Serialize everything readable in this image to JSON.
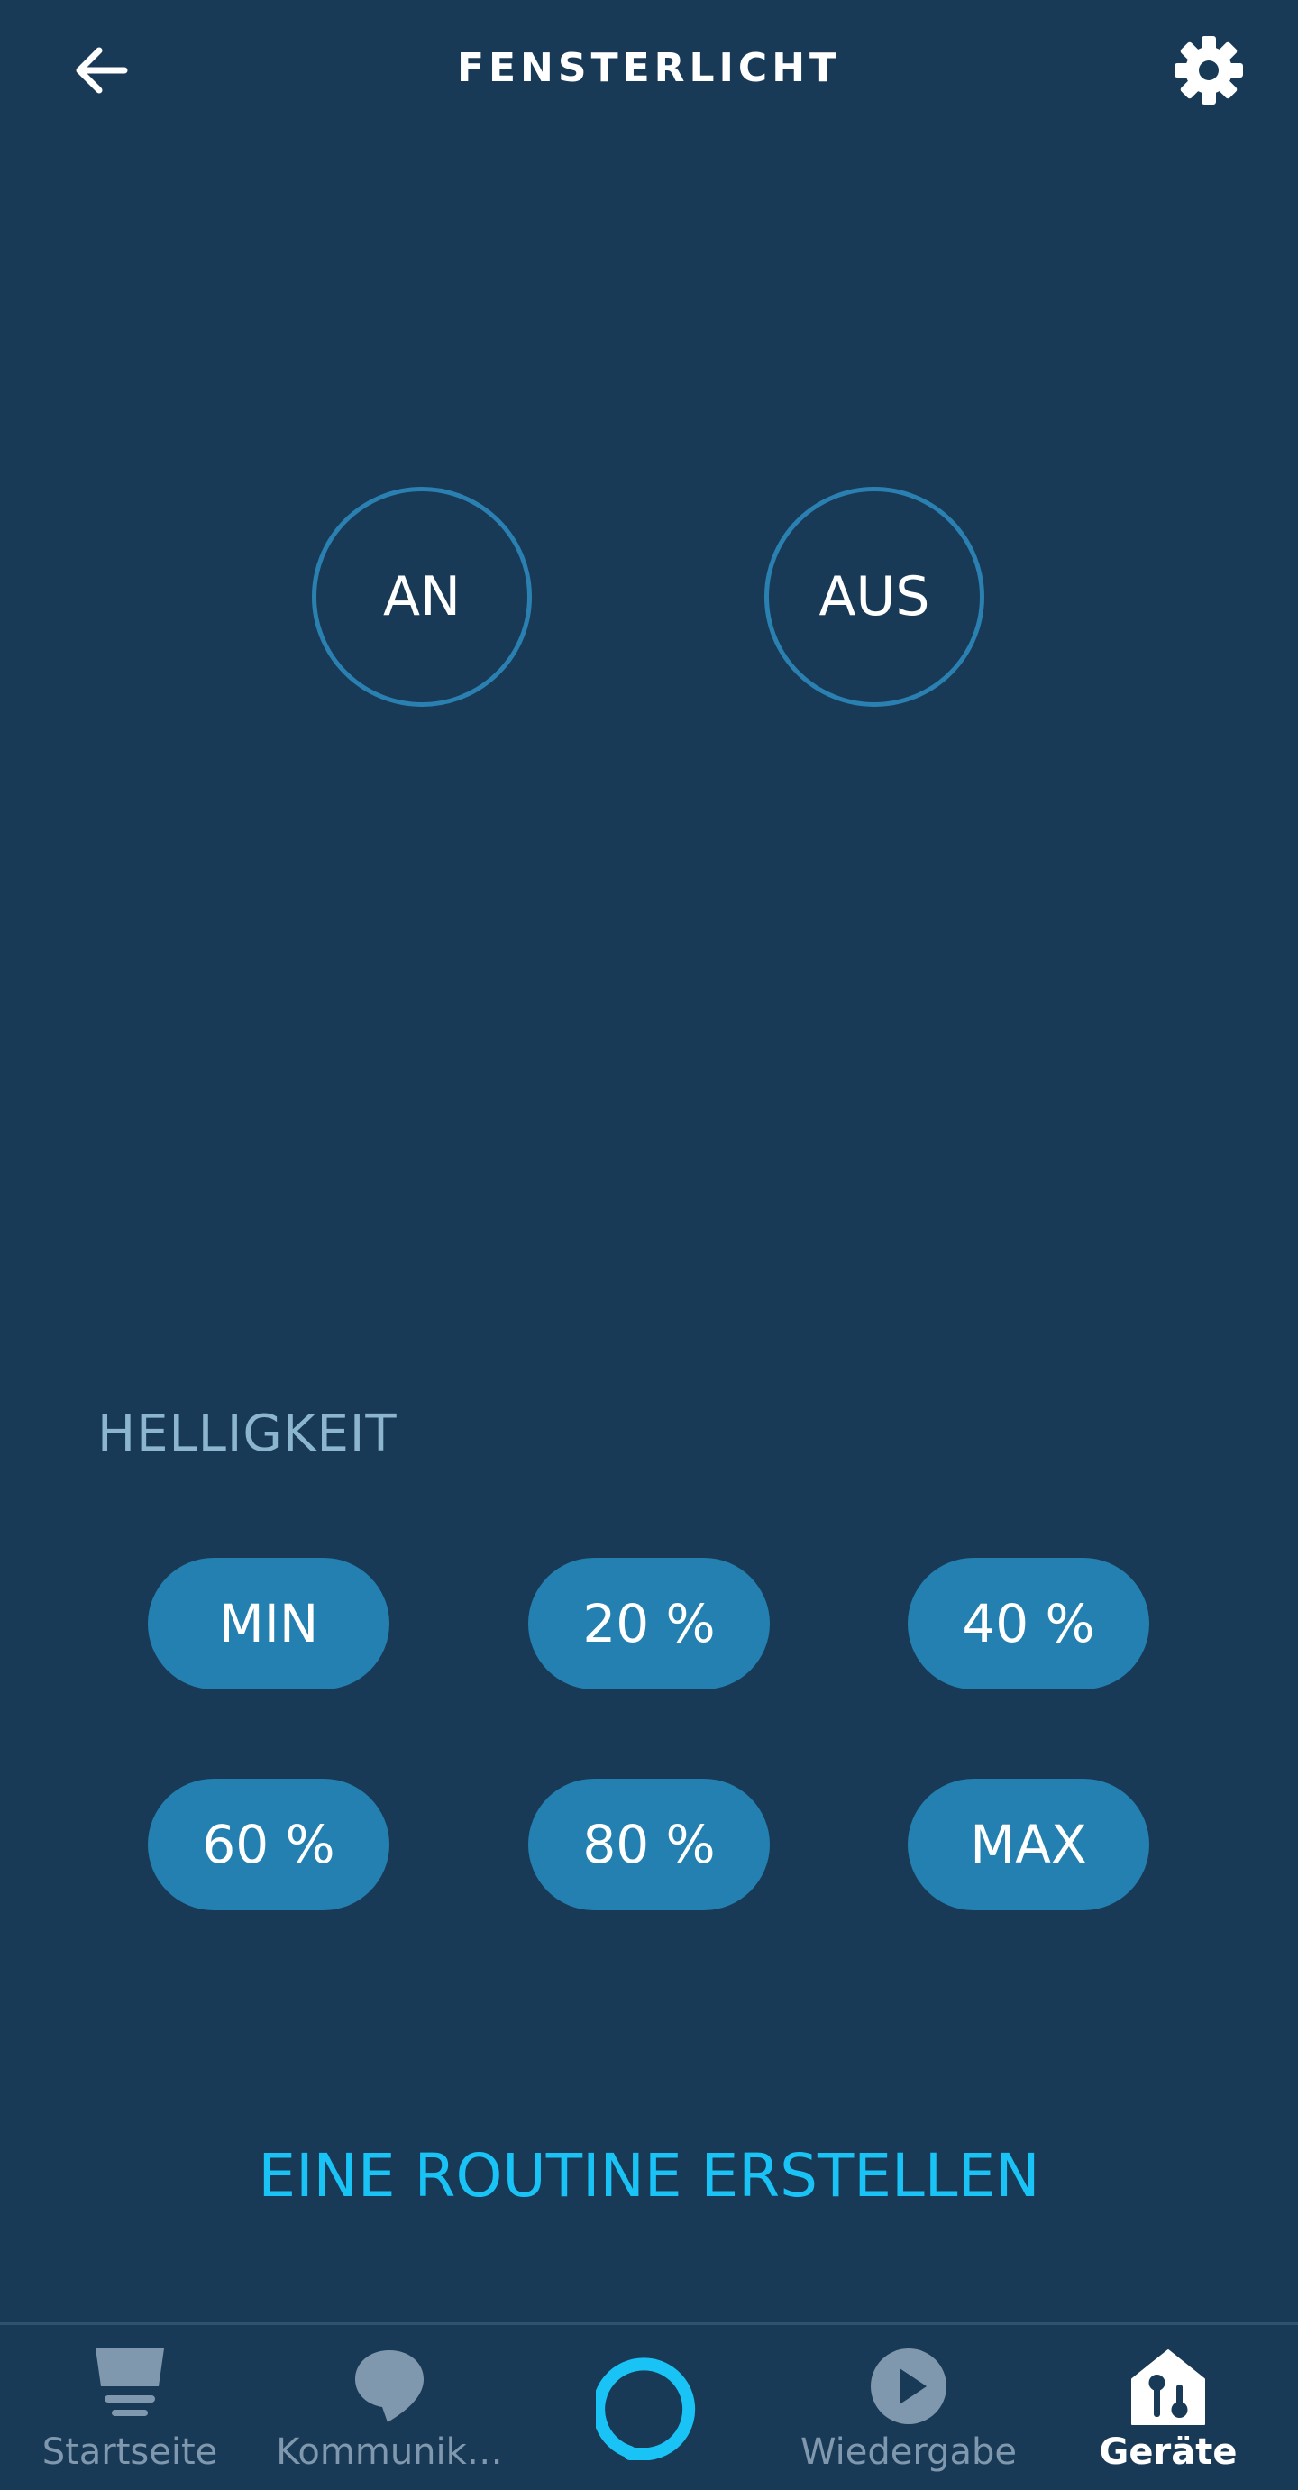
{
  "header": {
    "title": "FENSTERLICHT",
    "back_icon": "arrow-left-icon",
    "settings_icon": "gear-icon"
  },
  "power": {
    "on_label": "AN",
    "off_label": "AUS"
  },
  "brightness": {
    "label": "HELLIGKEIT",
    "options": [
      "MIN",
      "20 %",
      "40 %",
      "60 %",
      "80 %",
      "MAX"
    ]
  },
  "routine": {
    "label": "EINE ROUTINE ERSTELLEN"
  },
  "nav": {
    "items": [
      {
        "label": "Startseite",
        "icon": "home-feed-icon",
        "active": false
      },
      {
        "label": "Kommunik…",
        "icon": "chat-bubble-icon",
        "active": false
      },
      {
        "label": "",
        "icon": "alexa-ring-icon",
        "active": false
      },
      {
        "label": "Wiedergabe",
        "icon": "play-icon",
        "active": false
      },
      {
        "label": "Geräte",
        "icon": "devices-house-icon",
        "active": true
      }
    ]
  },
  "colors": {
    "background": "#193a56",
    "accent": "#1ac3f6",
    "pill": "#2380b0",
    "ring": "#2a81b1",
    "section_label": "#8cb6cd",
    "nav_inactive": "#7f98ad"
  }
}
